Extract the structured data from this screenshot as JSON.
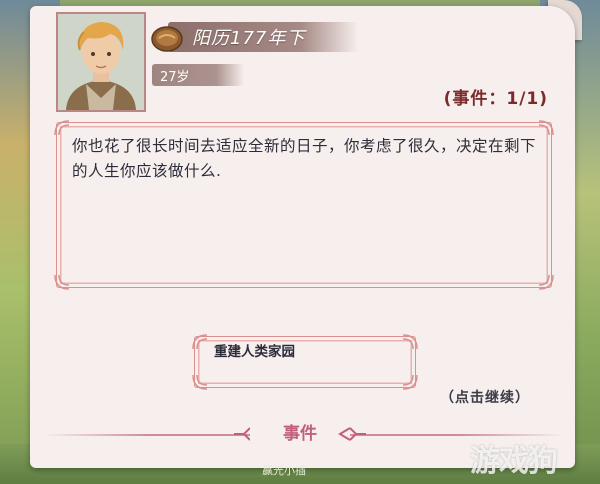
{
  "character": {
    "era": "阳历177年下",
    "age": "27岁"
  },
  "event": {
    "counter": "(事件：1/1)",
    "story": "你也花了很长时间去适应全新的日子，你考虑了很久，决定在剩下的人生你应该做什么.",
    "choices": [
      {
        "label": "重建人类家园"
      }
    ],
    "continue_hint": "（点击继续）",
    "footer_title": "事件"
  },
  "watermark": "游戏狗",
  "background_text": "赢光小插",
  "colors": {
    "paper": "#f6efed",
    "border_pink": "#d9908e",
    "counter_text": "#7c2b2d",
    "footer_title": "#c2607c"
  },
  "icons": [
    "portrait-image",
    "coin-icon",
    "ornament-corner",
    "flourish-icon"
  ]
}
